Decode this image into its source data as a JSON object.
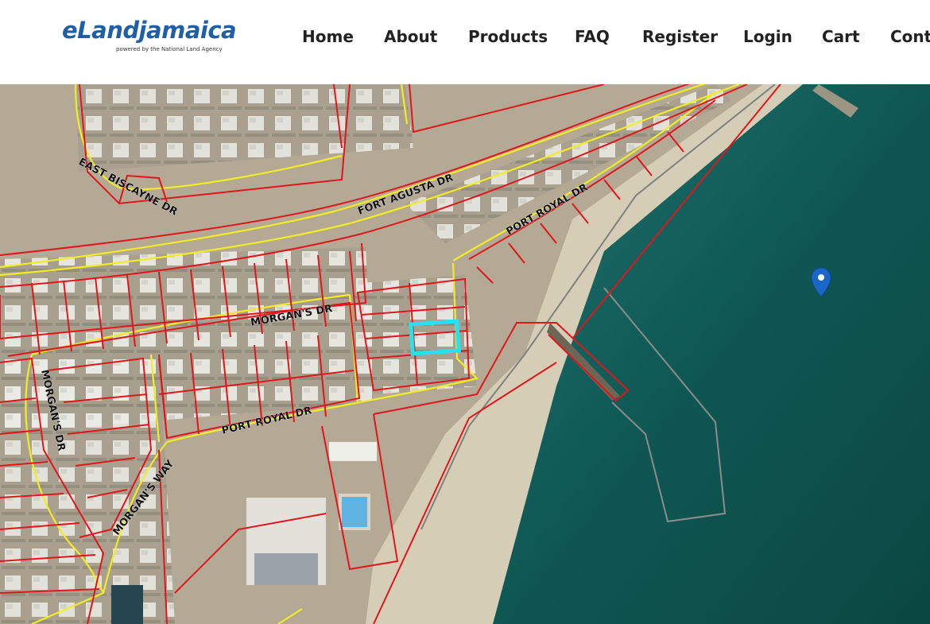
{
  "brand": {
    "name": "eLandjamaica",
    "tagline": "powered by the National Land Agency",
    "color": "#1f5fa8"
  },
  "nav": {
    "items": [
      {
        "label": "Home"
      },
      {
        "label": "About"
      },
      {
        "label": "Products"
      },
      {
        "label": "FAQ"
      },
      {
        "label": "Register"
      },
      {
        "label": "Login"
      },
      {
        "label": "Cart"
      },
      {
        "label": "Conta"
      }
    ]
  },
  "map": {
    "road_labels": {
      "east_biscayne": "EAST BISCAYNE DR",
      "fort_agusta": "FORT AGUSTA DR",
      "port_royal_upper": "PORT ROYAL DR",
      "morgans_dr_top": "MORGAN'S DR",
      "morgans_dr_left": "MORGAN'S DR",
      "port_royal_lower": "PORT ROYAL DR",
      "morgans_way": "MORGAN'S WAY"
    },
    "colors": {
      "parcel_boundary": "#e0161b",
      "road_centerline": "#f2ec24",
      "highlight_parcel": "#25e2f0",
      "water": "#0f5450",
      "marker": "#1a66c9"
    },
    "icons": [
      "location-pin-icon"
    ]
  }
}
